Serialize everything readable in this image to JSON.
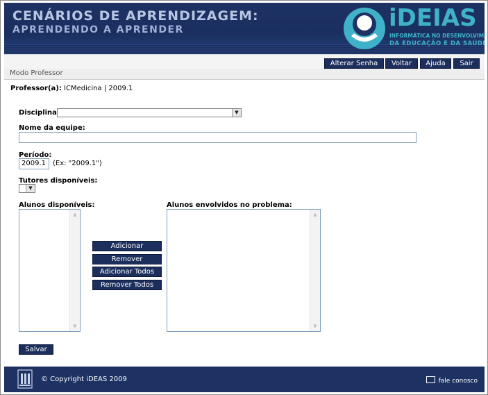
{
  "header": {
    "title_line1": "CENÁRIOS DE APRENDIZAGEM:",
    "title_line2": "APRENDENDO A APRENDER",
    "logo_text": "iDEIAS",
    "logo_sub1": "INFORMÁTICA NO DESENVOLVIMENTO",
    "logo_sub2": "DA EDUCAÇÃO E DA SAÚDE"
  },
  "nav": {
    "change_password": "Alterar Senha",
    "back": "Voltar",
    "help": "Ajuda",
    "exit": "Sair"
  },
  "mode": "Modo Professor",
  "professor": {
    "label": "Professor(a):",
    "value": "ICMedicina | 2009.1"
  },
  "form": {
    "discipline_label": "Disciplina:",
    "discipline_value": "",
    "team_name_label": "Nome da equipe:",
    "team_name_value": "",
    "period_label": "Período:",
    "period_value": "2009.1",
    "period_hint": "(Ex: \"2009.1\")",
    "tutors_label": "Tutores disponíveis:",
    "tutors_value": "",
    "available_students_label": "Alunos disponíveis:",
    "involved_students_label": "Alunos envolvidos no problema:",
    "available_students": [],
    "involved_students": []
  },
  "actions": {
    "add": "Adicionar",
    "remove": "Remover",
    "add_all": "Adicionar Todos",
    "remove_all": "Remover Todos",
    "save": "Salvar"
  },
  "footer": {
    "copyright": "© Copyright iDEAS 2009",
    "contact": "fale conosco"
  },
  "colors": {
    "header_bg": "#1d3263",
    "button_bg": "#1c2e5c",
    "logo_accent": "#3fb2c9"
  },
  "icons": {
    "logo": "ideias-logo-icon",
    "dropdown": "chevron-down-icon",
    "mail": "mail-icon",
    "emblem": "university-emblem-icon"
  }
}
